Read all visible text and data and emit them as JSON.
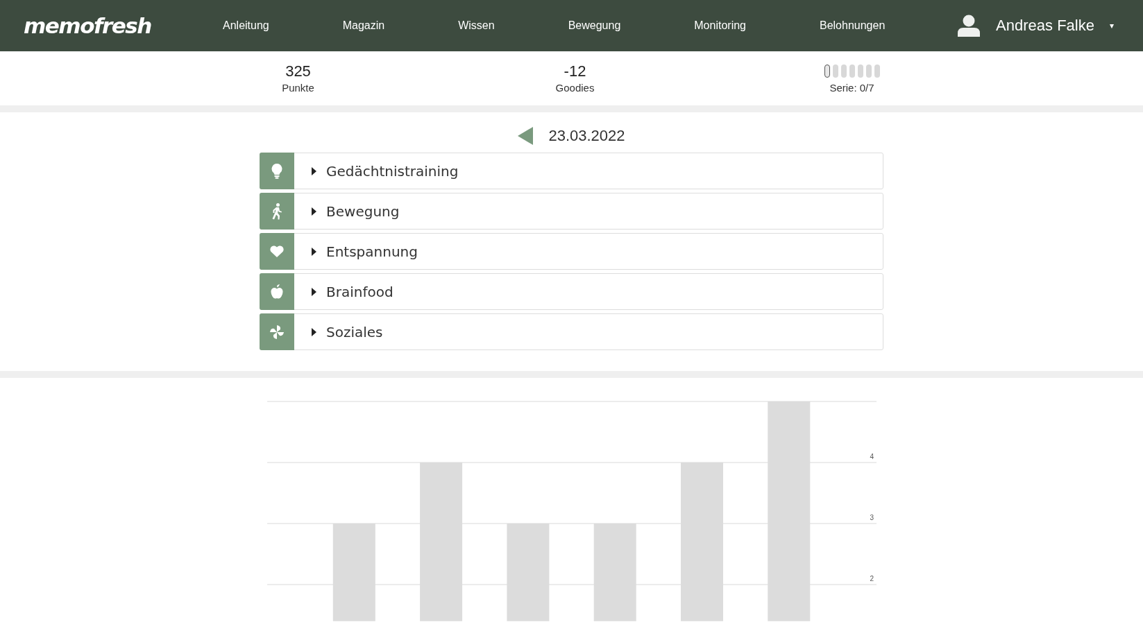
{
  "header": {
    "logo": "memofresh",
    "nav": [
      "Anleitung",
      "Magazin",
      "Wissen",
      "Bewegung",
      "Monitoring",
      "Belohnungen"
    ],
    "user": {
      "name": "Andreas Falke",
      "menu_caret": "▾"
    }
  },
  "stats": {
    "points": {
      "value": "325",
      "label": "Punkte"
    },
    "goodies": {
      "value": "-12",
      "label": "Goodies"
    },
    "streak": {
      "pills": [
        {
          "current": true
        },
        {
          "current": false
        },
        {
          "current": false
        },
        {
          "current": false
        },
        {
          "current": false
        },
        {
          "current": false
        },
        {
          "current": false
        }
      ],
      "label": "Serie: 0/7"
    }
  },
  "day": {
    "date": "23.03.2022"
  },
  "categories": [
    {
      "kind": "bulb",
      "label": "Gedächtnistraining",
      "expanded": false
    },
    {
      "kind": "walk",
      "label": "Bewegung",
      "expanded": false
    },
    {
      "kind": "heart",
      "label": "Entspannung",
      "expanded": false
    },
    {
      "kind": "apple",
      "label": "Brainfood",
      "expanded": false
    },
    {
      "kind": "pinwheel",
      "label": "Soziales",
      "expanded": false
    }
  ],
  "chart": {
    "chart_data": {
      "type": "bar",
      "values": [
        3,
        4,
        3,
        3,
        4,
        5
      ],
      "ylim": [
        1.4,
        5
      ],
      "yticks": [
        2,
        3,
        4
      ],
      "grid": true
    }
  }
}
